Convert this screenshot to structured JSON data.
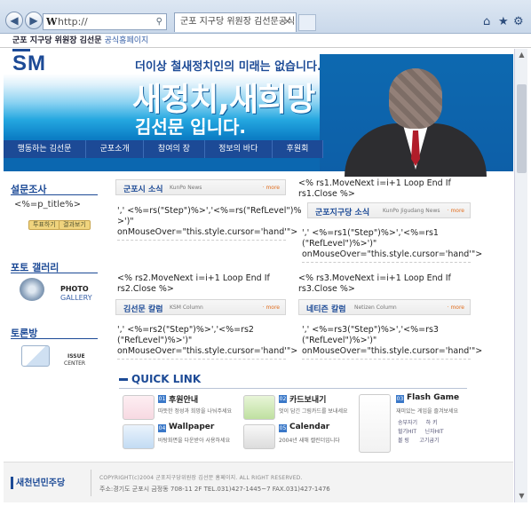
{
  "browser": {
    "address": "http://",
    "tab_title": "군포 지구당 위원장 김선문공식...",
    "tab_close": "×",
    "window_title": "군포 지구당 위원장 김선문",
    "window_subtitle": "공식홈페이지",
    "search_glyph": "⚲",
    "back": "◀",
    "forward": "▶",
    "home": "⌂",
    "star": "★",
    "gear": "⚙"
  },
  "banner": {
    "logo": "SM",
    "slogan": "더이상 철새정치인의 미래는 없습니다.",
    "headline": "새정치,새희망",
    "subhead": "김선문 입니다."
  },
  "nav": [
    "행동하는 김선문",
    "군포소개",
    "참여의 장",
    "정보의 바다",
    "후원회"
  ],
  "sidebar": {
    "poll_title": "설문조사",
    "poll_value": "<%=p_title%>",
    "poll_btn1": "투표하기",
    "poll_btn2": "결과보기",
    "gallery_title": "포토 갤러리",
    "gallery_label1": "PHOTO",
    "gallery_label2": "GALLERY",
    "issue_title": "토론방",
    "issue_label1": "ISSUE",
    "issue_label2": "CENTER"
  },
  "boxes": {
    "b1": {
      "title": "군포시 소식",
      "sub": "KunPo News",
      "more": "· more",
      "pre": "",
      "code": [
        "',' <%=rs(\"Step\")%>','<%=rs(\"RefLevel\")%",
        ">')\"",
        "onMouseOver=\"this.style.cursor='hand'\">"
      ]
    },
    "b2": {
      "title": "군포지구당 소식",
      "sub": "KunPo Jigudang News",
      "more": "· more",
      "pre": [
        "<% rs1.MoveNext i=i+1 Loop End If",
        "rs1.Close %>"
      ],
      "code": [
        "',' <%=rs1(\"Step\")%>','<%=rs1",
        "(\"RefLevel\")%>')\"",
        "onMouseOver=\"this.style.cursor='hand'\">"
      ]
    },
    "b3": {
      "title": "김선문 칼럼",
      "sub": "KSM Column",
      "more": "· more",
      "pre": [
        "<% rs2.MoveNext i=i+1 Loop End If",
        "rs2.Close %>"
      ],
      "code": [
        "',' <%=rs2(\"Step\")%>','<%=rs2",
        "(\"RefLevel\")%>')\"",
        "onMouseOver=\"this.style.cursor='hand'\">"
      ]
    },
    "b4": {
      "title": "네티즌 칼럼",
      "sub": "Netizen Column",
      "more": "· more",
      "pre": [
        "<% rs3.MoveNext i=i+1 Loop End If",
        "rs3.Close %>"
      ],
      "code": [
        "',' <%=rs3(\"Step\")%>','<%=rs3",
        "(\"RefLevel\")%>')\"",
        "onMouseOver=\"this.style.cursor='hand'\">"
      ]
    }
  },
  "quick": {
    "title": "QUICK LINK",
    "items": [
      {
        "num": "01",
        "name": "후원안내",
        "desc": "따뜻한 정성과 희망을 나눠주세요"
      },
      {
        "num": "02",
        "name": "카드보내기",
        "desc": "멋이 담긴 그림카드를 보내세요"
      },
      {
        "num": "03",
        "name": "Flash Game",
        "desc": "재미있는 게임을 즐겨보세요"
      },
      {
        "num": "04",
        "name": "Wallpaper",
        "desc": "바탕화면을 다운받아 사용하세요"
      },
      {
        "num": "05",
        "name": "Calendar",
        "desc": "2004년 새해 캘린더입니다"
      }
    ],
    "games": [
      [
        "송부자기",
        "하 키"
      ],
      [
        "헐기HIT",
        "닌자HIT"
      ],
      [
        "볼 링",
        "고기굽기"
      ]
    ]
  },
  "footer": {
    "logo": "새천년민주당",
    "line1": "COPYRIGHT(c)2004 군포지구당위원장 김선문 홈페이지. ALL RIGHT RESERVED.",
    "line2": "주소:경기도 군포시 금정동 708-11 2F TEL.031)427-1445~7   FAX.031)427-1476"
  }
}
